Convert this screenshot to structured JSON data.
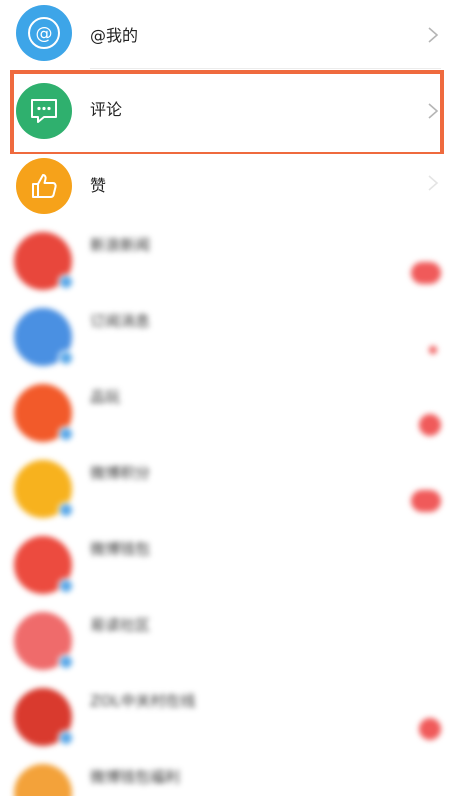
{
  "rows": {
    "mention": {
      "label": "@我的",
      "icon": "at-icon",
      "color": "#3da5e8"
    },
    "comment": {
      "label": "评论",
      "icon": "comment-icon",
      "color": "#2fb06e"
    },
    "like": {
      "label": "赞",
      "icon": "thumbs-up-icon",
      "color": "#f6a21a"
    }
  },
  "highlight_color": "#ef6a3e",
  "conversations": [
    {
      "name": "新浪新闻",
      "preview": "",
      "time": "",
      "avatar_color": "#e8473c",
      "badge": "wide"
    },
    {
      "name": "订阅消息",
      "preview": "",
      "time": "",
      "avatar_color": "#4a90e2",
      "badge": "dot"
    },
    {
      "name": "品玩",
      "preview": "",
      "time": "",
      "avatar_color": "#f25a2a",
      "badge": "round"
    },
    {
      "name": "微博积分",
      "preview": "",
      "time": "",
      "avatar_color": "#f7b21e",
      "badge": "wide"
    },
    {
      "name": "微博钱包",
      "preview": "",
      "time": "",
      "avatar_color": "#ec4b3f",
      "badge": "none"
    },
    {
      "name": "易读社区",
      "preview": "",
      "time": "",
      "avatar_color": "#ef6b6b",
      "badge": "none"
    },
    {
      "name": "ZOL中关村在线",
      "preview": "",
      "time": "",
      "avatar_color": "#d93a2e",
      "badge": "round"
    },
    {
      "name": "微博钱包福利",
      "preview": "",
      "time": "",
      "avatar_color": "#f3a23a",
      "badge": "none"
    }
  ]
}
